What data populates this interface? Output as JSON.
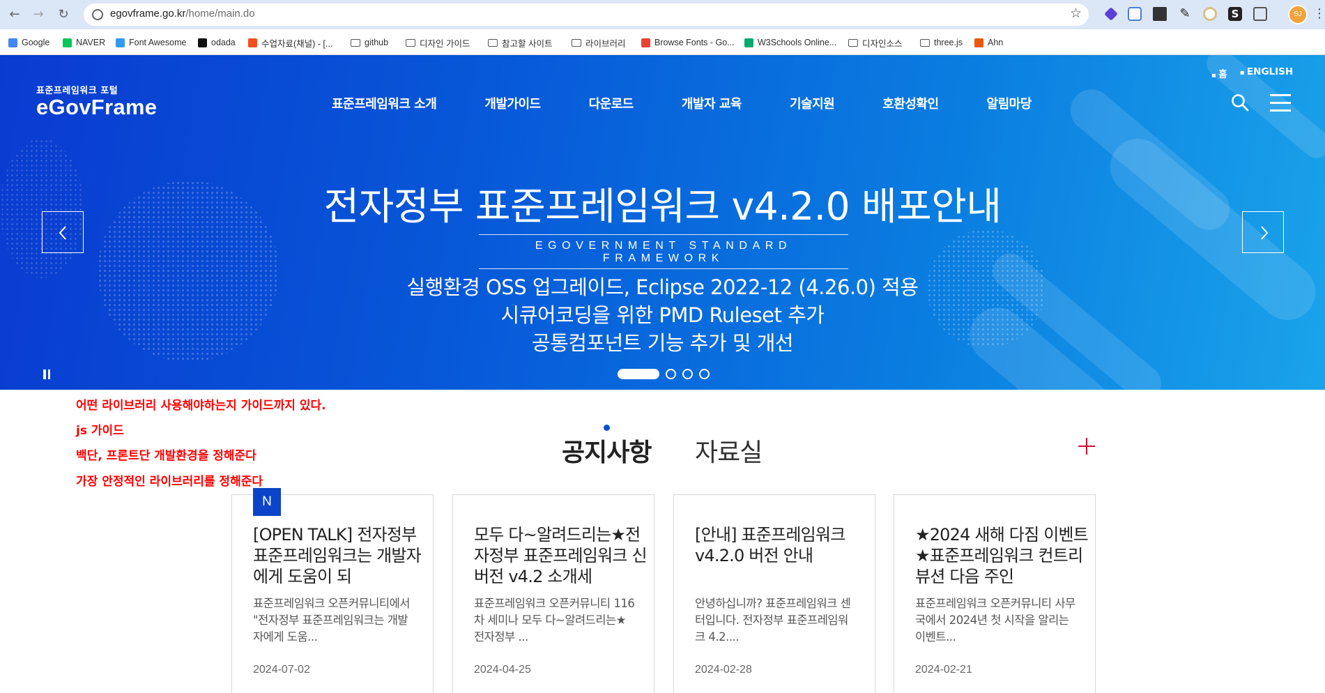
{
  "browser": {
    "url_host": "egovframe.go.kr",
    "url_path": "/home/main.do",
    "profile_initials": "SJ",
    "bookmarks": [
      {
        "label": "Google",
        "icon": "google-icon",
        "color": "#4285f4"
      },
      {
        "label": "NAVER",
        "icon": "naver-icon",
        "color": "#03c75a"
      },
      {
        "label": "Font Awesome",
        "icon": "flag-icon",
        "color": "#339af0"
      },
      {
        "label": "odada",
        "icon": "odada-icon",
        "color": "#111111"
      },
      {
        "label": "수업자료(채널) - [...",
        "icon": "figma-icon",
        "color": "#f24e1e"
      },
      {
        "label": "github",
        "icon": "folder-icon"
      },
      {
        "label": "디자인 가이드",
        "icon": "folder-icon"
      },
      {
        "label": "참고할 사이트",
        "icon": "folder-icon"
      },
      {
        "label": "라이브러리",
        "icon": "folder-icon"
      },
      {
        "label": "Browse Fonts - Go...",
        "icon": "google-fonts-icon",
        "color": "#ea4335"
      },
      {
        "label": "W3Schools Online...",
        "icon": "w3schools-icon",
        "color": "#04aa6d"
      },
      {
        "label": "디자인소스",
        "icon": "folder-icon"
      },
      {
        "label": "three.js",
        "icon": "folder-icon"
      },
      {
        "label": "Ahn",
        "icon": "ahn-icon",
        "color": "#e8590c"
      }
    ]
  },
  "site": {
    "logo_small": "표준프레임워크 포털",
    "logo_big": "eGovFrame",
    "top_links": [
      "홈",
      "ENGLISH"
    ],
    "nav": [
      "표준프레임워크 소개",
      "개발가이드",
      "다운로드",
      "개발자 교육",
      "기술지원",
      "호환성확인",
      "알림마당"
    ]
  },
  "hero": {
    "title": "전자정부 표준프레임워크 v4.2.0 배포안내",
    "subtitle": "EGOVERNMENT STANDARD FRAMEWORK",
    "lines": [
      "실행환경 OSS 업그레이드, Eclipse 2022-12 (4.26.0) 적용",
      "시큐어코딩을 위한 PMD Ruleset 추가",
      "공통컴포넌트 기능 추가 및 개선"
    ],
    "slide_count": 4,
    "active_slide": 1
  },
  "annotations": [
    "어떤 라이브러리 사용해야하는지 가이드까지 있다.",
    "js 가이드",
    "백단, 프론트단 개발환경을 정해준다",
    "가장 안정적인 라이브러리를 정해준다"
  ],
  "tabs": {
    "notice": "공지사항",
    "data": "자료실"
  },
  "cards": [
    {
      "badge": "N",
      "title": "[OPEN TALK] 전자정부 표준프레임워크는 개발자에게 도움이 되",
      "body": "표준프레임워크 오픈커뮤니티에서 \"전자정부 표준프레임워크는 개발자에게 도움...",
      "date": "2024-07-02"
    },
    {
      "badge": "",
      "title": "모두 다~알려드리는★전자정부 표준프레임워크 신버전 v4.2 소개세",
      "body": "표준프레임워크 오픈커뮤니티 116차 세미나 모두 다~알려드리는★전자정부 ...",
      "date": "2024-04-25"
    },
    {
      "badge": "",
      "title": "[안내] 표준프레임워크 v4.2.0 버전 안내",
      "body": "안녕하십니까? 표준프레임워크 센터입니다. 전자정부 표준프레임워크 4.2....",
      "date": "2024-02-28"
    },
    {
      "badge": "",
      "title": "★2024 새해 다짐 이벤트★표준프레임워크 컨트리뷰션 다음 주인",
      "body": "표준프레임워크 오픈커뮤니티 사무국에서 2024년 첫 시작을 알리는 이벤트...",
      "date": "2024-02-21"
    }
  ],
  "colors": {
    "hero_start": "#0a3bd0",
    "hero_end": "#1aa3ea",
    "badge": "#0b44c8",
    "annotation": "#ff0000",
    "plus": "#c8102e"
  }
}
